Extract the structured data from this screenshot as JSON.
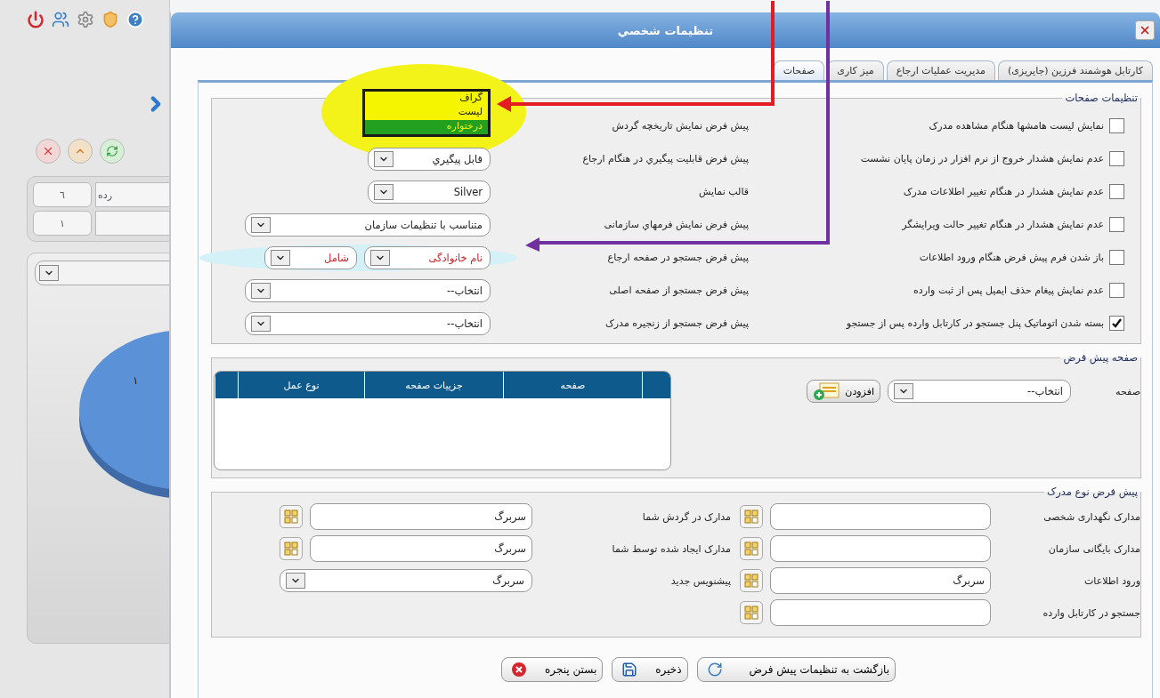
{
  "background": {
    "stat_rows": [
      {
        "value": "٦",
        "label": "رده"
      },
      {
        "value": "١"
      }
    ],
    "pie_label": "١"
  },
  "window": {
    "title": "تنظيمات شخصي"
  },
  "tabs": [
    {
      "label": "کارتابل هوشمند فرزین (جایریزی)",
      "selected": false
    },
    {
      "label": "مدیریت عملیات ارجاع",
      "selected": false
    },
    {
      "label": "میز کاری",
      "selected": false
    },
    {
      "label": "صفحات",
      "selected": true
    }
  ],
  "page_settings": {
    "legend": "تنظیمات صفحات",
    "options": [
      {
        "label": "نمایش لیست هامشها هنگام مشاهده مدرک",
        "checked": false
      },
      {
        "label": "عدم نمایش هشدار خروج از نرم افزار در زمان پایان نشست",
        "checked": false
      },
      {
        "label": "عدم نمایش هشدار در هنگام تغییر اطلاعات مدرک",
        "checked": false
      },
      {
        "label": "عدم نمایش هشدار در هنگام تغییر حالت ویرایشگر",
        "checked": false
      },
      {
        "label": "باز شدن فرم پیش فرض هنگام ورود اطلاعات",
        "checked": false
      },
      {
        "label": "عدم نمایش پیغام حذف ایمیل پس از ثبت وارده",
        "checked": false
      },
      {
        "label": "بسته شدن اتوماتیک پنل جستجو در کارتابل وارده پس از جستجو",
        "checked": true
      }
    ],
    "defaults": [
      {
        "label": "پیش فرض نمایش تاریخچه گردش",
        "kind": "listbox",
        "highlighted": true,
        "items": [
          {
            "label": "گراف",
            "selected": false
          },
          {
            "label": "لیست",
            "selected": false
          },
          {
            "label": "درختواره",
            "selected": true
          }
        ]
      },
      {
        "label": "پیش فرض قابلیت پیگیري در هنگام ارجاع",
        "kind": "select",
        "highlighted": false,
        "value": "قابل پیگیري"
      },
      {
        "label": "قالب نمایش",
        "kind": "select",
        "highlighted": false,
        "value": "Silver"
      },
      {
        "label": "پیش فرض نمایش فرمهاي سازمانی",
        "kind": "wide_select",
        "highlighted": false,
        "value": "متناسب با تنظیمات سازمان"
      },
      {
        "label": "پیش فرض جستجو در صفحه ارجاع",
        "kind": "select_pair",
        "highlighted": true,
        "values": [
          "نام خانوادگی",
          "شامل"
        ]
      },
      {
        "label": "پیش فرض جستجو از صفحه اصلی",
        "kind": "wide_select",
        "highlighted": false,
        "value": "انتخاب--"
      },
      {
        "label": "پیش فرض جستجو از زنجیره مدرک",
        "kind": "wide_select",
        "highlighted": false,
        "value": "انتخاب--"
      }
    ]
  },
  "default_page": {
    "legend": "صفحه پیش فرض",
    "label": "صفحه",
    "select_value": "انتخاب--",
    "add_button": "افزودن",
    "columns": [
      "صفحه",
      "جزییات صفحه",
      "نوع عمل"
    ]
  },
  "document_types": {
    "legend": "پیش فرض نوع مدرک",
    "right": [
      {
        "label": "مدارک نگهداری شخصی",
        "kind": "picker"
      },
      {
        "label": "مدارک بایگانی سازمان",
        "kind": "picker"
      },
      {
        "label": "ورود اطلاعات",
        "kind": "picker",
        "value": "سربرگ"
      },
      {
        "label": "جستجو در کارتابل وارده",
        "kind": "picker"
      }
    ],
    "left": [
      {
        "label": "مدارک در گردش شما",
        "kind": "picker",
        "value": "سربرگ"
      },
      {
        "label": "مدارک ایجاد شده توسط شما",
        "kind": "picker",
        "value": "سربرگ"
      },
      {
        "label": "پیشنویس جدید",
        "kind": "select",
        "value": "سربرگ"
      }
    ]
  },
  "buttons": [
    {
      "label": "بازگشت به تنظیمات پیش فرض",
      "kind": "reset"
    },
    {
      "label": "ذخیره",
      "kind": "save"
    },
    {
      "label": "بستن پنجره",
      "kind": "close"
    }
  ],
  "annotations": [
    {
      "kind": "arrow",
      "color": "#e31b23"
    },
    {
      "kind": "arrow",
      "color": "#7030a0"
    }
  ]
}
